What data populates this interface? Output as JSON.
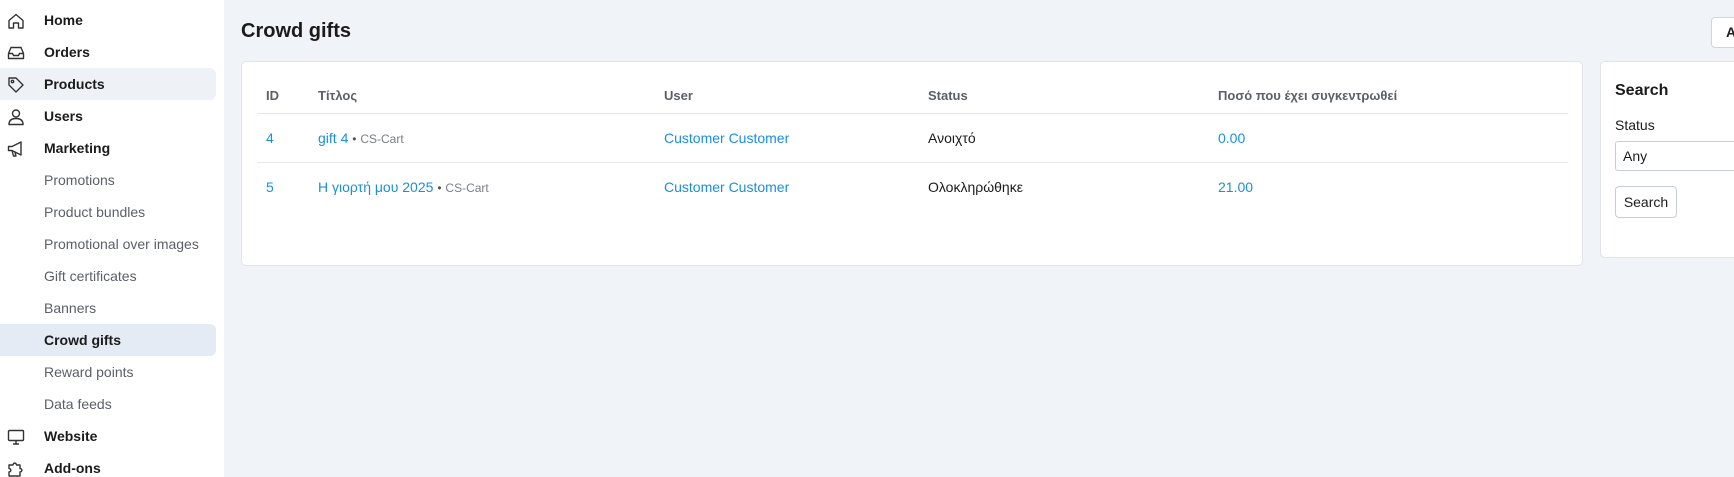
{
  "sidebar": {
    "items": [
      {
        "label": "Home",
        "icon": "home-icon"
      },
      {
        "label": "Orders",
        "icon": "inbox-icon"
      },
      {
        "label": "Products",
        "icon": "tag-icon"
      },
      {
        "label": "Users",
        "icon": "user-icon"
      },
      {
        "label": "Marketing",
        "icon": "megaphone-icon"
      },
      {
        "label": "Promotions"
      },
      {
        "label": "Product bundles"
      },
      {
        "label": "Promotional over images"
      },
      {
        "label": "Gift certificates"
      },
      {
        "label": "Banners"
      },
      {
        "label": "Crowd gifts"
      },
      {
        "label": "Reward points"
      },
      {
        "label": "Data feeds"
      },
      {
        "label": "Website",
        "icon": "monitor-icon"
      },
      {
        "label": "Add-ons",
        "icon": "puzzle-icon"
      }
    ]
  },
  "page": {
    "title": "Crowd gifts",
    "top_button_label": "A"
  },
  "table": {
    "columns": [
      "ID",
      "Τίτλος",
      "User",
      "Status",
      "Ποσό που έχει συγκεντρωθεί"
    ],
    "rows": [
      {
        "id": "4",
        "title": "gift 4",
        "separator": "•",
        "vendor": "CS-Cart",
        "user": "Customer Customer",
        "status": "Ανοιχτό",
        "amount": "0.00"
      },
      {
        "id": "5",
        "title": "Η γιορτή μου 2025",
        "separator": "•",
        "vendor": "CS-Cart",
        "user": "Customer Customer",
        "status": "Ολοκληρώθηκε",
        "amount": "21.00"
      }
    ]
  },
  "search": {
    "title": "Search",
    "status_label": "Status",
    "status_value": "Any",
    "button_label": "Search"
  },
  "colors": {
    "link": "#1a8fe0",
    "active_bg": "#e4ebf4",
    "page_bg": "#f0f3f8"
  }
}
